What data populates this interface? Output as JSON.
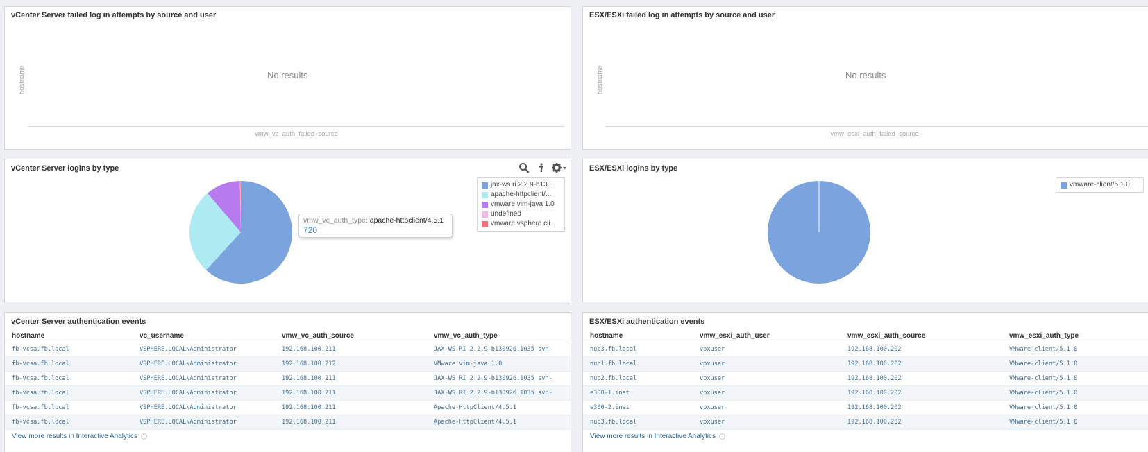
{
  "panels": {
    "vc_failed": {
      "title": "vCenter Server failed log in attempts by source and user",
      "no_results": "No results",
      "y_label": "hostname",
      "x_label": "vmw_vc_auth_failed_source"
    },
    "esx_failed": {
      "title": "ESX/ESXi failed log in attempts by source and user",
      "no_results": "No results",
      "y_label": "hostname",
      "x_label": "vmw_esxi_auth_failed_source"
    },
    "vc_logins": {
      "title": "vCenter Server logins by type",
      "tooltip": {
        "key": "vmw_vc_auth_type:",
        "value": "apache-httpclient/4.5.1",
        "count": "720"
      }
    },
    "esx_logins": {
      "title": "ESX/ESXi logins by type"
    },
    "vc_events": {
      "title": "vCenter Server authentication events",
      "columns": [
        "hostname",
        "vc_username",
        "vmw_vc_auth_source",
        "vmw_vc_auth_type"
      ],
      "rows": [
        [
          "fb-vcsa.fb.local",
          "VSPHERE.LOCAL\\Administrator",
          "192.168.100.211",
          "JAX-WS RI 2.2.9-b130926.1035 svn-"
        ],
        [
          "fb-vcsa.fb.local",
          "VSPHERE.LOCAL\\Administrator",
          "192.168.100.212",
          "VMware vim-java 1.0"
        ],
        [
          "fb-vcsa.fb.local",
          "VSPHERE.LOCAL\\Administrator",
          "192.168.100.211",
          "JAX-WS RI 2.2.9-b130926.1035 svn-"
        ],
        [
          "fb-vcsa.fb.local",
          "VSPHERE.LOCAL\\Administrator",
          "192.168.100.211",
          "JAX-WS RI 2.2.9-b130926.1035 svn-"
        ],
        [
          "fb-vcsa.fb.local",
          "VSPHERE.LOCAL\\Administrator",
          "192.168.100.211",
          "Apache-HttpClient/4.5.1"
        ],
        [
          "fb-vcsa.fb.local",
          "VSPHERE.LOCAL\\Administrator",
          "192.168.100.211",
          "Apache-HttpClient/4.5.1"
        ]
      ],
      "more_link": "View more results in Interactive Analytics"
    },
    "esx_events": {
      "title": "ESX/ESXi authentication events",
      "columns": [
        "hostname",
        "vmw_esxi_auth_user",
        "vmw_esxi_auth_source",
        "vmw_esxi_auth_type"
      ],
      "rows": [
        [
          "nuc3.fb.local",
          "vpxuser",
          "192.168.100.202",
          "VMware-client/5.1.0"
        ],
        [
          "nuc1.fb.local",
          "vpxuser",
          "192.168.100.202",
          "VMware-client/5.1.0"
        ],
        [
          "nuc2.fb.local",
          "vpxuser",
          "192.168.100.202",
          "VMware-client/5.1.0"
        ],
        [
          "e300-1.inet",
          "vpxuser",
          "192.168.100.202",
          "VMware-client/5.1.0"
        ],
        [
          "e300-2.inet",
          "vpxuser",
          "192.168.100.202",
          "VMware-client/5.1.0"
        ],
        [
          "nuc3.fb.local",
          "vpxuser",
          "192.168.100.202",
          "VMware-client/5.1.0"
        ]
      ],
      "more_link": "View more results in Interactive Analytics"
    }
  },
  "chart_data": [
    {
      "type": "pie",
      "title": "vCenter Server logins by type",
      "labels": [
        "jax-ws ri 2.2.9-b13...",
        "apache-httpclient/...",
        "vmware vim-java 1.0",
        "undefined",
        "vmware vsphere cli..."
      ],
      "values": [
        62,
        27,
        11,
        0.2,
        0.1
      ],
      "colors": [
        "#7ba3de",
        "#aeeaf2",
        "#b77bef",
        "#f0b9e4",
        "#f0747b"
      ],
      "legend_position": "top-right"
    },
    {
      "type": "pie",
      "title": "ESX/ESXi logins by type",
      "labels": [
        "vmware-client/5.1.0"
      ],
      "values": [
        100
      ],
      "colors": [
        "#7ba3de"
      ],
      "legend_position": "top-right"
    }
  ]
}
